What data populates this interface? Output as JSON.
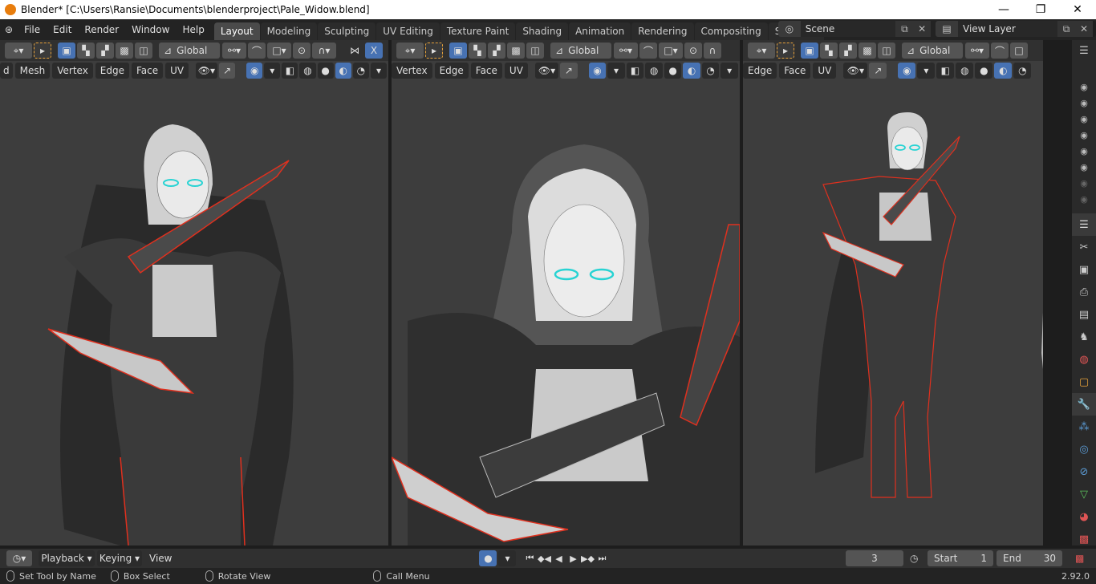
{
  "window": {
    "title": "Blender* [C:\\Users\\Ransie\\Documents\\blenderproject\\Pale_Widow.blend]",
    "controls": [
      "—",
      "❐",
      "✕"
    ]
  },
  "menu": {
    "items": [
      "File",
      "Edit",
      "Render",
      "Window",
      "Help"
    ]
  },
  "workspaces": {
    "tabs": [
      "Layout",
      "Modeling",
      "Sculpting",
      "UV Editing",
      "Texture Paint",
      "Shading",
      "Animation",
      "Rendering",
      "Compositing",
      "Scripting"
    ],
    "active": "Layout",
    "add": "+"
  },
  "scene": {
    "name": "Scene"
  },
  "view_layer": {
    "name": "View Layer"
  },
  "viewport1": {
    "orientation": "Global",
    "select_modes": [
      "d",
      "Mesh",
      "Vertex",
      "Edge",
      "Face",
      "UV"
    ],
    "axis": "X"
  },
  "viewport2": {
    "orientation": "Global",
    "select_modes": [
      "Vertex",
      "Edge",
      "Face",
      "UV"
    ]
  },
  "viewport3": {
    "orientation": "Global",
    "select_modes": [
      "Edge",
      "Face",
      "UV"
    ]
  },
  "timeline": {
    "menus": [
      "Playback",
      "Keying",
      "View"
    ],
    "current_frame": "3",
    "start_label": "Start",
    "start": "1",
    "end_label": "End",
    "end": "30"
  },
  "status": {
    "items": [
      "Set Tool by Name",
      "Box Select",
      "Rotate View",
      "Call Menu"
    ],
    "version": "2.92.0"
  },
  "colors": {
    "accent": "#4772b3",
    "selection_outline": "#e0301e",
    "eye_highlight": "#27d3d3"
  }
}
